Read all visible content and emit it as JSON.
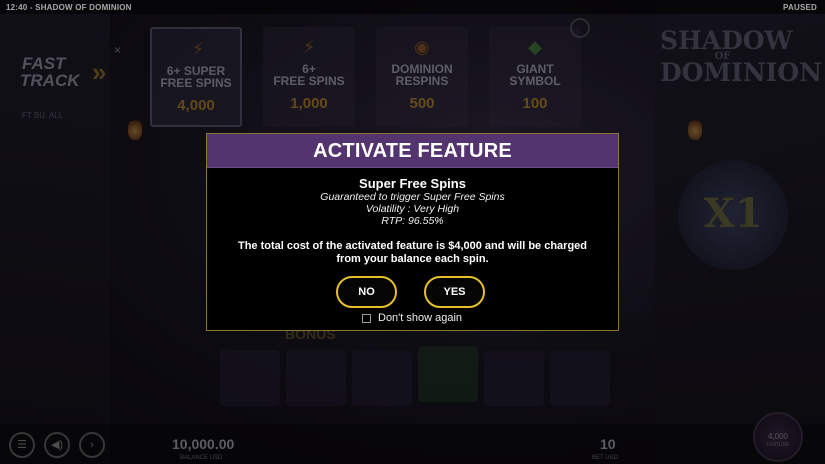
{
  "status_bar": {
    "left": "12:40 - SHADOW OF DOMINION",
    "right": "PAUSED"
  },
  "fast_track": {
    "line1": "FAST",
    "line2": "TRACK",
    "chevrons": "»",
    "close": "×",
    "sub": "FT BU. ALL"
  },
  "feature_cards": [
    {
      "name_l1": "6+ SUPER",
      "name_l2": "FREE SPINS",
      "price": "4,000",
      "icon": "lightning-icon",
      "selected": true
    },
    {
      "name_l1": "6+",
      "name_l2": "FREE SPINS",
      "price": "1,000",
      "icon": "lightning-icon",
      "selected": false
    },
    {
      "name_l1": "DOMINION",
      "name_l2": "RESPINS",
      "price": "500",
      "icon": "coin-icon",
      "selected": false
    },
    {
      "name_l1": "GIANT",
      "name_l2": "SYMBOL",
      "price": "100",
      "icon": "gem-icon",
      "selected": false
    }
  ],
  "game_logo": {
    "l1": "SHADOW",
    "l2": "OF",
    "l3": "DOMINION"
  },
  "multiplier": "X1",
  "bonus_label": "BONUS",
  "bottom": {
    "balance": "10,000.00",
    "balance_label": "BALANCE USD",
    "bet": "10",
    "bet_label": "BET USD",
    "spin_value": "4,000",
    "spin_label": "FEATURE"
  },
  "dialog": {
    "title": "ACTIVATE FEATURE",
    "feature_name": "Super Free Spins",
    "line1": "Guaranteed to trigger Super Free Spins",
    "line2": "Volatility : Very High",
    "line3": "RTP: 96.55%",
    "cost_text_1": "The total cost of the activated feature is $4,000 and will be charged",
    "cost_text_2": "from your balance each spin.",
    "no_label": "NO",
    "yes_label": "YES",
    "dont_show": "Don't show again"
  },
  "colors": {
    "header_purple": "#53346e",
    "button_gold": "#e6c02a",
    "dialog_border": "#8a7532"
  }
}
